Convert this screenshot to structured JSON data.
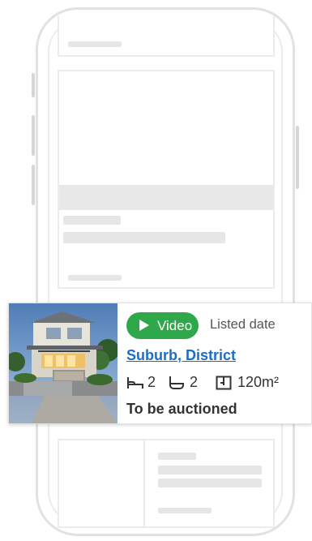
{
  "card": {
    "video_label": "Video",
    "listed_label": "Listed date",
    "location": "Suburb, District",
    "beds": "2",
    "baths": "2",
    "area": "120m²",
    "status": "To be auctioned"
  },
  "colors": {
    "video_green": "#2ea84a",
    "link_blue": "#1b6ec2",
    "wireframe_gray": "#e6e6e6"
  },
  "icons": [
    "play-icon",
    "bed-icon",
    "bath-icon",
    "floorplan-icon"
  ]
}
